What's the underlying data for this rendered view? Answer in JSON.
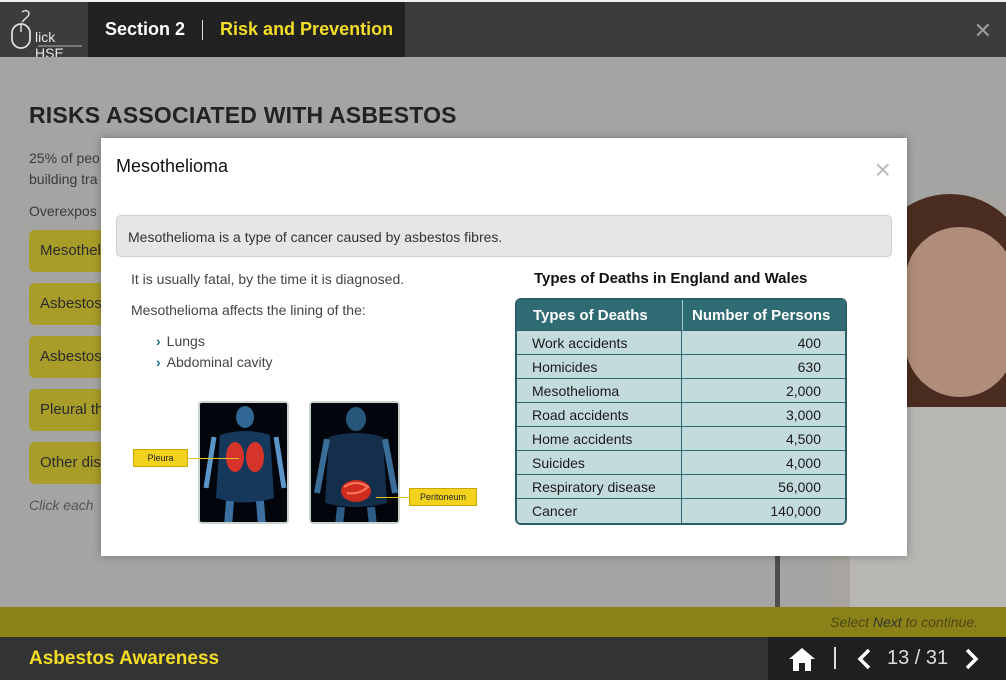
{
  "header": {
    "logo_text": "lick HSE",
    "section_label": "Section 2",
    "section_title": "Risk and Prevention",
    "close_icon": "close-icon"
  },
  "background": {
    "heading": "RISKS ASSOCIATED WITH ASBESTOS",
    "para_line1": "25% of peo",
    "para_line2": "building tra",
    "para_line3": "Overexpos",
    "buttons": [
      "Mesothel",
      "Asbestos",
      "Asbestos",
      "Pleural th",
      "Other dis"
    ],
    "hint": "Click each"
  },
  "strip": {
    "prefix": "Select ",
    "next_word": "Next",
    "suffix": " to continue."
  },
  "footer": {
    "course_title": "Asbestos Awareness",
    "page_indicator": "13 / 31"
  },
  "modal": {
    "title": "Mesothelioma",
    "callout": "Mesothelioma is a type of cancer caused by asbestos fibres.",
    "line1": "It is usually fatal, by the time it is diagnosed.",
    "line2": "Mesothelioma affects the lining of the:",
    "bullets": [
      "Lungs",
      "Abdominal cavity"
    ],
    "labels": {
      "pleura": "Pleura",
      "peritoneum": "Peritoneum"
    },
    "table": {
      "title": "Types of Deaths in England and Wales",
      "headers": [
        "Types of Deaths",
        "Number of Persons"
      ],
      "rows": [
        [
          "Work accidents",
          "400"
        ],
        [
          "Homicides",
          "630"
        ],
        [
          "Mesothelioma",
          "2,000"
        ],
        [
          "Road accidents",
          "3,000"
        ],
        [
          "Home accidents",
          "4,500"
        ],
        [
          "Suicides",
          "4,000"
        ],
        [
          "Respiratory disease",
          "56,000"
        ],
        [
          "Cancer",
          "140,000"
        ]
      ]
    }
  },
  "colors": {
    "accent_yellow": "#f3dd27",
    "table_header": "#2f6b73",
    "table_cell": "#c4dbdd",
    "chevron": "#1f6f8b"
  }
}
